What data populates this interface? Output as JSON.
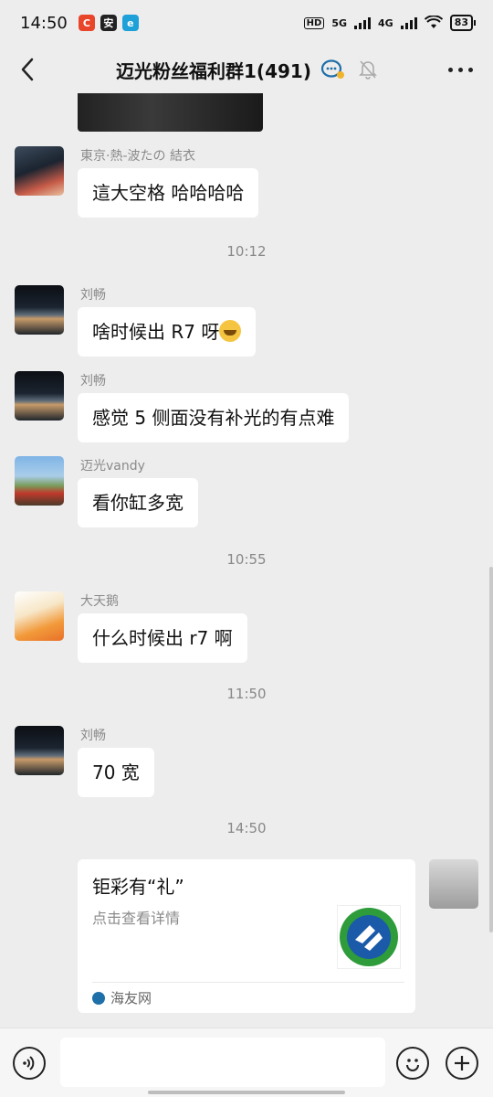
{
  "status_bar": {
    "time": "14:50",
    "hd": "HD",
    "net1": "5G",
    "net2": "4G",
    "battery": "83"
  },
  "navbar": {
    "title": "迈光粉丝福利群1(491)"
  },
  "timestamps": [
    "10:12",
    "10:55",
    "11:50",
    "14:50"
  ],
  "messages": [
    {
      "sender": "東京·熱-波たの 結衣",
      "text": "這大空格 哈哈哈哈"
    },
    {
      "sender": "刘畅",
      "text": "啥时候出 R7 呀"
    },
    {
      "sender": "刘畅",
      "text": "感觉 5 侧面没有补光的有点难"
    },
    {
      "sender": "迈光vandy",
      "text": "看你缸多宽"
    },
    {
      "sender": "大天鹅",
      "text": "什么时候出 r7 啊"
    },
    {
      "sender": "刘畅",
      "text": "70 宽"
    }
  ],
  "link_card": {
    "title": "钜彩有“礼”",
    "description": "点击查看详情",
    "source": "海友网"
  },
  "input": {
    "placeholder": ""
  },
  "colors": {
    "background": "#ededed",
    "bubble": "#ffffff",
    "timestamp": "#888888",
    "sender": "#8a8a8a",
    "accent_blue": "#1f6fa8"
  },
  "icons": [
    "back-icon",
    "group-chat-icon",
    "mute-bell-icon",
    "more-icon",
    "voice-icon",
    "emoji-icon",
    "plus-icon"
  ]
}
